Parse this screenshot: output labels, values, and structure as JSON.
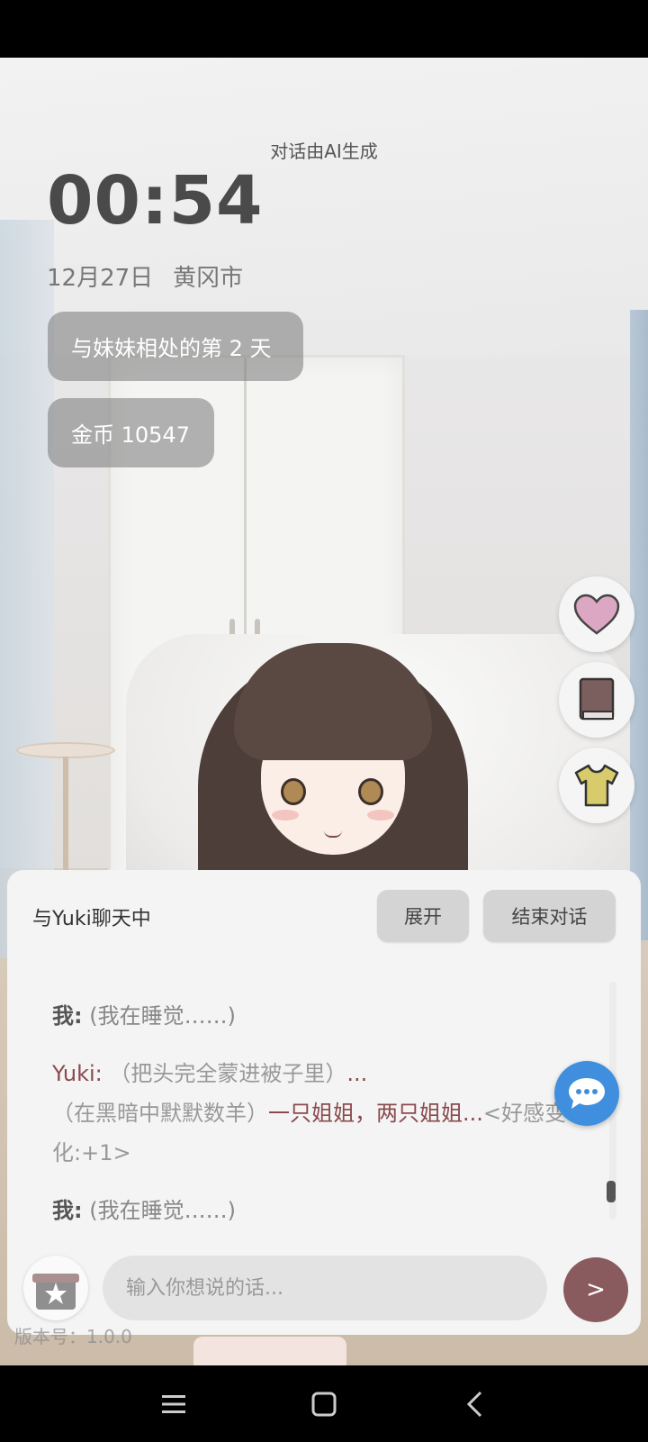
{
  "header": {
    "ai_note": "对话由AI生成",
    "clock": "00:54",
    "date": "12月27日",
    "city": "黄冈市"
  },
  "stats": {
    "days_label": "与妹妹相处的第 2 天",
    "coins_label": "金币 10547"
  },
  "side_actions": [
    {
      "icon": "heart-icon",
      "color": "#d9a6c0"
    },
    {
      "icon": "book-icon",
      "color": "#7b5a5a"
    },
    {
      "icon": "shirt-icon",
      "color": "#d9c96a"
    }
  ],
  "chat": {
    "title": "与Yuki聊天中",
    "expand_label": "展开",
    "end_label": "结束对话",
    "messages": [
      {
        "speaker": "我:",
        "text": "(我在睡觉……)"
      },
      {
        "speaker": "Yuki:",
        "text_a": "（把头完全蒙进被子里）",
        "text_b": "...",
        "text_c": "（在黑暗中默默数羊）",
        "text_d": "一只姐姐，两只姐姐...",
        "text_e": "<好感变化:+1>"
      },
      {
        "speaker": "我:",
        "text": "(我在睡觉……)"
      }
    ],
    "input_placeholder": "输入你想说的话...",
    "send_label": ">",
    "version": "版本号：1.0.0"
  },
  "colors": {
    "accent": "#8a5b5e",
    "yuki_name": "#8a4a4e",
    "bubble_blue": "#3f8fde"
  }
}
